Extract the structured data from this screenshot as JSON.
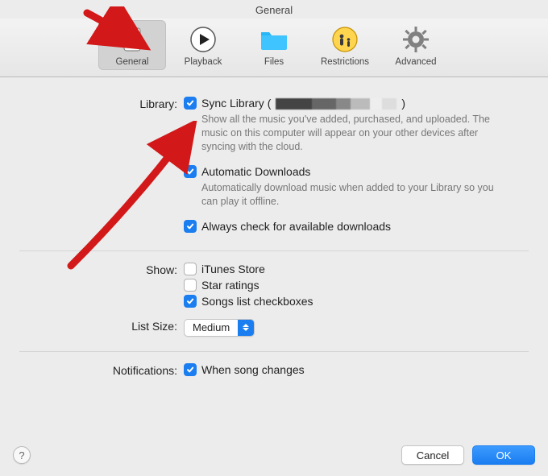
{
  "windowTitle": "General",
  "toolbar": {
    "items": [
      {
        "id": "general",
        "label": "General",
        "active": true
      },
      {
        "id": "playback",
        "label": "Playback",
        "active": false
      },
      {
        "id": "files",
        "label": "Files",
        "active": false
      },
      {
        "id": "restrictions",
        "label": "Restrictions",
        "active": false
      },
      {
        "id": "advanced",
        "label": "Advanced",
        "active": false
      }
    ]
  },
  "sections": {
    "library": {
      "label": "Library:",
      "syncLibrary": {
        "checked": true,
        "label": "Sync Library (",
        "labelClose": ")",
        "desc": "Show all the music you've added, purchased, and uploaded. The music on this computer will appear on your other devices after syncing with the cloud."
      },
      "automaticDownloads": {
        "checked": true,
        "label": "Automatic Downloads",
        "desc": "Automatically download music when added to your Library so you can play it offline."
      },
      "alwaysCheck": {
        "checked": true,
        "label": "Always check for available downloads"
      }
    },
    "show": {
      "label": "Show:",
      "itunesStore": {
        "checked": false,
        "label": "iTunes Store"
      },
      "starRatings": {
        "checked": false,
        "label": "Star ratings"
      },
      "songsListCb": {
        "checked": true,
        "label": "Songs list checkboxes"
      }
    },
    "listSize": {
      "label": "List Size:",
      "value": "Medium"
    },
    "notifications": {
      "label": "Notifications:",
      "whenSongChanges": {
        "checked": true,
        "label": "When song changes"
      }
    }
  },
  "footer": {
    "help": "?",
    "cancel": "Cancel",
    "ok": "OK"
  },
  "colors": {
    "accent": "#1a7df0",
    "annotationRed": "#d21818"
  }
}
